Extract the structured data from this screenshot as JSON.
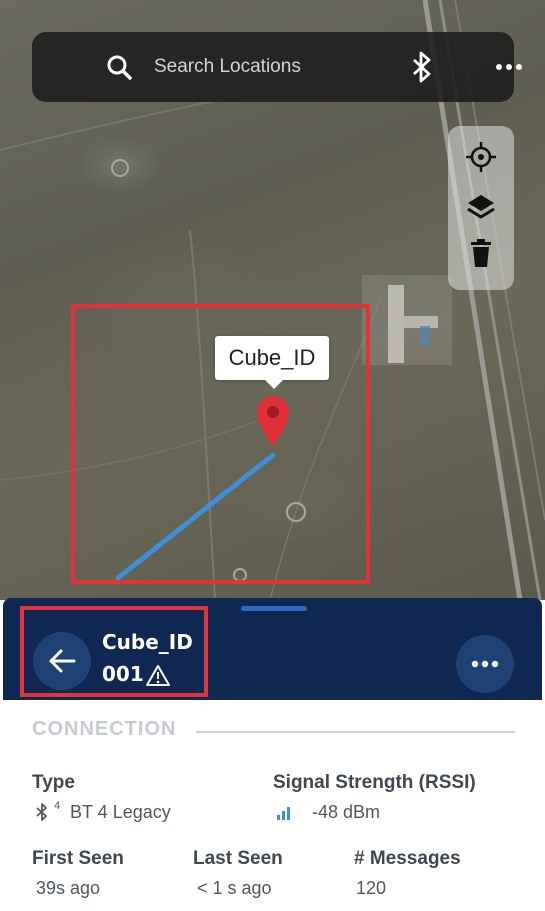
{
  "search": {
    "placeholder": "Search Locations"
  },
  "map": {
    "callout_label": "Cube_ID",
    "tools": [
      "crosshair-icon",
      "layers-icon",
      "trash-icon"
    ]
  },
  "device": {
    "name": "Cube_ID",
    "id": "001"
  },
  "details": {
    "section_title": "CONNECTION",
    "type": {
      "label": "Type",
      "sup": "4",
      "value": "BT 4 Legacy"
    },
    "signal": {
      "label": "Signal Strength (RSSI)",
      "value": "-48 dBm"
    },
    "first_seen": {
      "label": "First Seen",
      "value": "39s ago"
    },
    "last_seen": {
      "label": "Last Seen",
      "value": "< 1 s ago"
    },
    "messages": {
      "label": "# Messages",
      "value": "120"
    }
  },
  "colors": {
    "panel": "#0f2852",
    "highlight": "#e2333a",
    "pin": "#e0313a",
    "track": "#3f8ed8"
  }
}
